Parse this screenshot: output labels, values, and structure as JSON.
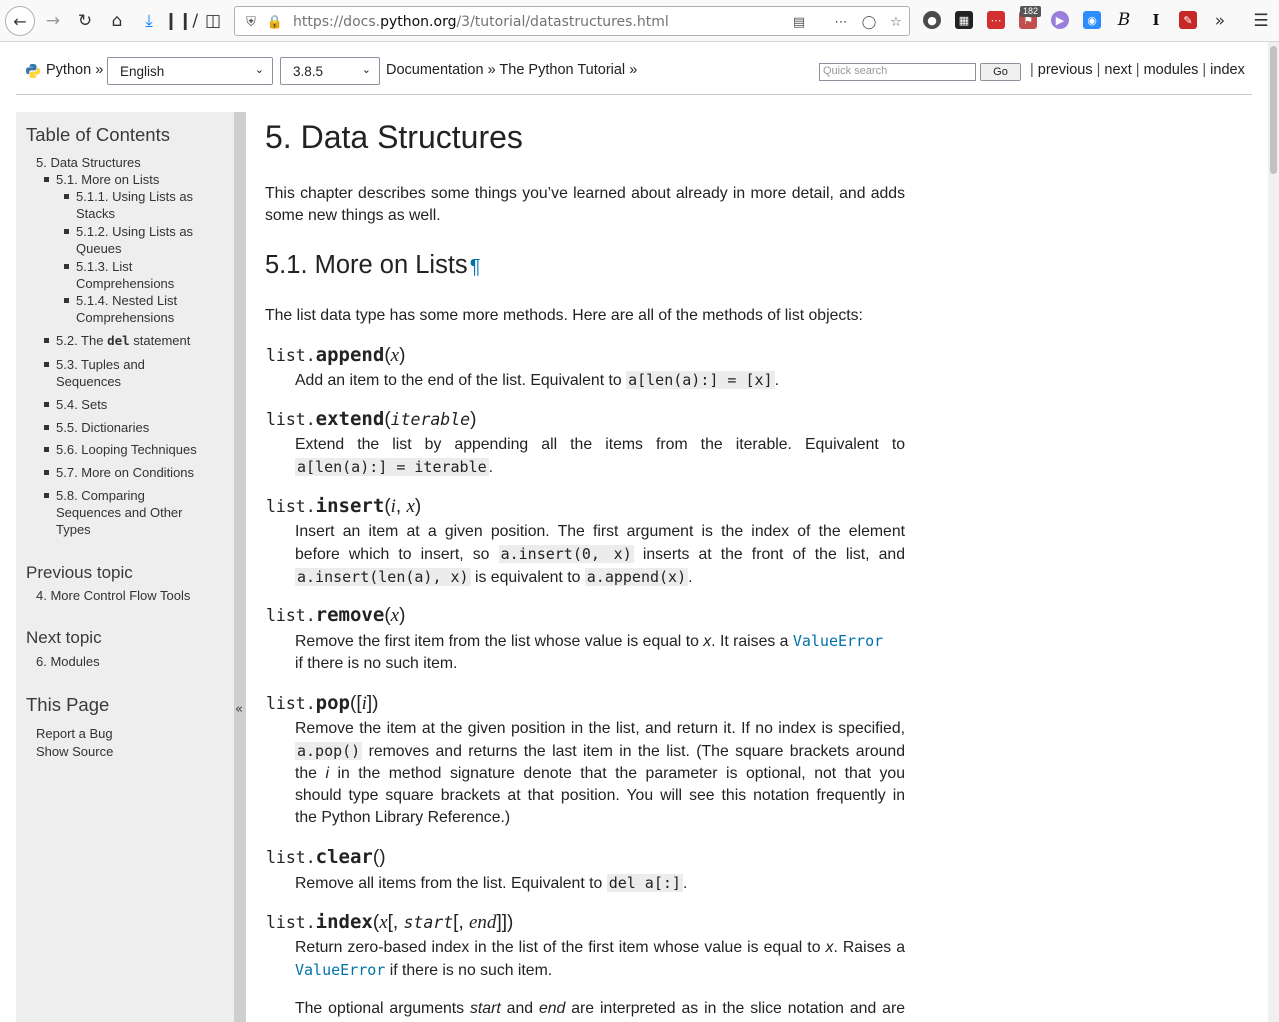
{
  "browser": {
    "url_prefix": "https://docs.",
    "url_domain": "python.org",
    "url_path": "/3/tutorial/datastructures.html",
    "badge_count": "182"
  },
  "nav": {
    "python_label": "Python",
    "sep": "»",
    "language": "English",
    "version": "3.8.5",
    "breadcrumb_docs": "Documentation",
    "breadcrumb_tutorial": "The Python Tutorial",
    "search_placeholder": "Quick search",
    "go_label": "Go",
    "previous": "previous",
    "next": "next",
    "modules": "modules",
    "index": "index",
    "pipe": "|"
  },
  "sidebar": {
    "toc_title": "Table of Contents",
    "toc": {
      "s5": "5. Data Structures",
      "s51": "5.1. More on Lists",
      "s511a": "5.1.1. Using Lists as",
      "s511b": "Stacks",
      "s512a": "5.1.2. Using Lists as",
      "s512b": "Queues",
      "s513a": "5.1.3. List",
      "s513b": "Comprehensions",
      "s514a": "5.1.4. Nested List",
      "s514b": "Comprehensions",
      "s52_pre": "5.2. The ",
      "s52_code": "del",
      "s52_post": " statement",
      "s53a": "5.3. Tuples and",
      "s53b": "Sequences",
      "s54": "5.4. Sets",
      "s55": "5.5. Dictionaries",
      "s56": "5.6. Looping Techniques",
      "s57": "5.7. More on Conditions",
      "s58a": "5.8. Comparing",
      "s58b": "Sequences and Other",
      "s58c": "Types"
    },
    "prev_title": "Previous topic",
    "prev_link": "4. More Control Flow Tools",
    "next_title": "Next topic",
    "next_link": "6. Modules",
    "thispage_title": "This Page",
    "report_bug": "Report a Bug",
    "show_source": "Show Source",
    "collapse": "«"
  },
  "content": {
    "h1": "5. Data Structures",
    "intro": "This chapter describes some things you’ve learned about already in more detail, and adds some new things as well.",
    "h2": "5.1. More on Lists",
    "pilcrow": "¶",
    "lists_intro": "The list data type has some more methods. Here are all of the methods of list objects:",
    "cls": "list.",
    "append": {
      "name": "append",
      "open": "(",
      "arg": "x",
      "close": ")",
      "desc": "Add an item to the end of the list. Equivalent to ",
      "code": "a[len(a):] = [x]",
      "end": "."
    },
    "extend": {
      "name": "extend",
      "open": "(",
      "arg": "iterable",
      "close": ")",
      "desc": "Extend the list by appending all the items from the iterable. Equivalent to",
      "code": "a[len(a):] = iterable",
      "end": "."
    },
    "insert": {
      "name": "insert",
      "open": "(",
      "arg1": "i",
      "comma": ", ",
      "arg2": "x",
      "close": ")",
      "l1": "Insert an item at a given position. The first argument is the index of the element",
      "l2a": "before which to insert, so ",
      "l2code": "a.insert(0, x)",
      "l2b": " inserts at the front of the list, and",
      "l3code1": "a.insert(len(a), x)",
      "l3mid": " is equivalent to ",
      "l3code2": "a.append(x)",
      "end": "."
    },
    "remove": {
      "name": "remove",
      "open": "(",
      "arg": "x",
      "close": ")",
      "l1a": "Remove the first item from the list whose value is equal to ",
      "l1x": "x",
      "l1b": ". It raises a ",
      "l1code": "ValueError",
      "l2": "if there is no such item."
    },
    "pop": {
      "name": "pop",
      "open": "([",
      "arg": "i",
      "close": "])",
      "l1": "Remove the item at the given position in the list, and return it. If no index is specified,",
      "l2code": "a.pop()",
      "l2": " removes and returns the last item in the list. (The square brackets around",
      "l3a": "the ",
      "l3i": "i",
      "l3b": " in the method signature denote that the parameter is optional, not that you",
      "l4": "should type square brackets at that position. You will see this notation frequently in",
      "l5": "the Python Library Reference.)"
    },
    "clear": {
      "name": "clear",
      "open": "(",
      "close": ")",
      "desc": "Remove all items from the list. Equivalent to ",
      "code": "del a[:]",
      "end": "."
    },
    "index": {
      "name": "index",
      "open": "(",
      "arg": "x",
      "b1": "[",
      "c1": ", ",
      "start": "start",
      "b2": "[",
      "c2": ", ",
      "endarg": "end",
      "close": "]])",
      "l1a": "Return zero-based index in the list of the first item whose value is equal to ",
      "l1x": "x",
      "l1b": ". Raises a",
      "l2code": "ValueError",
      "l2": " if there is no such item.",
      "p2a": "The optional arguments ",
      "p2s": "start",
      "p2m": " and ",
      "p2e": "end",
      "p2b": " are interpreted as in the slice notation and are"
    }
  }
}
